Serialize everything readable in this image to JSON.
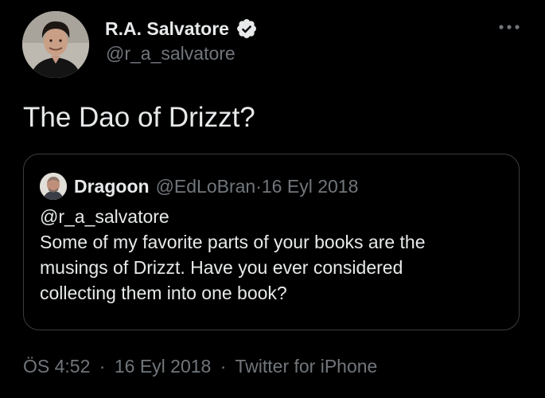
{
  "tweet": {
    "author": {
      "name": "R.A. Salvatore",
      "handle": "@r_a_salvatore",
      "verified": true
    },
    "text": "The Dao of Drizzt?",
    "quoted_tweet": {
      "author_name": "Dragoon",
      "author_handle": "@EdLoBran",
      "separator": "·",
      "date": "16 Eyl 2018",
      "body_lines": [
        "@r_a_salvatore",
        "Some of my favorite parts of your books are the",
        "musings of Drizzt.  Have you ever considered",
        "collecting them into one book?"
      ]
    },
    "footer": {
      "time": "ÖS 4:52",
      "separator": "·",
      "date": "16 Eyl 2018",
      "source": "Twitter for iPhone"
    }
  },
  "icons": {
    "verified": "verified-badge-icon",
    "more": "more-options-icon"
  },
  "colors": {
    "background": "#000000",
    "primary_text": "#e7e9ea",
    "secondary_text": "#71767b",
    "card_border": "#3a3d40"
  }
}
